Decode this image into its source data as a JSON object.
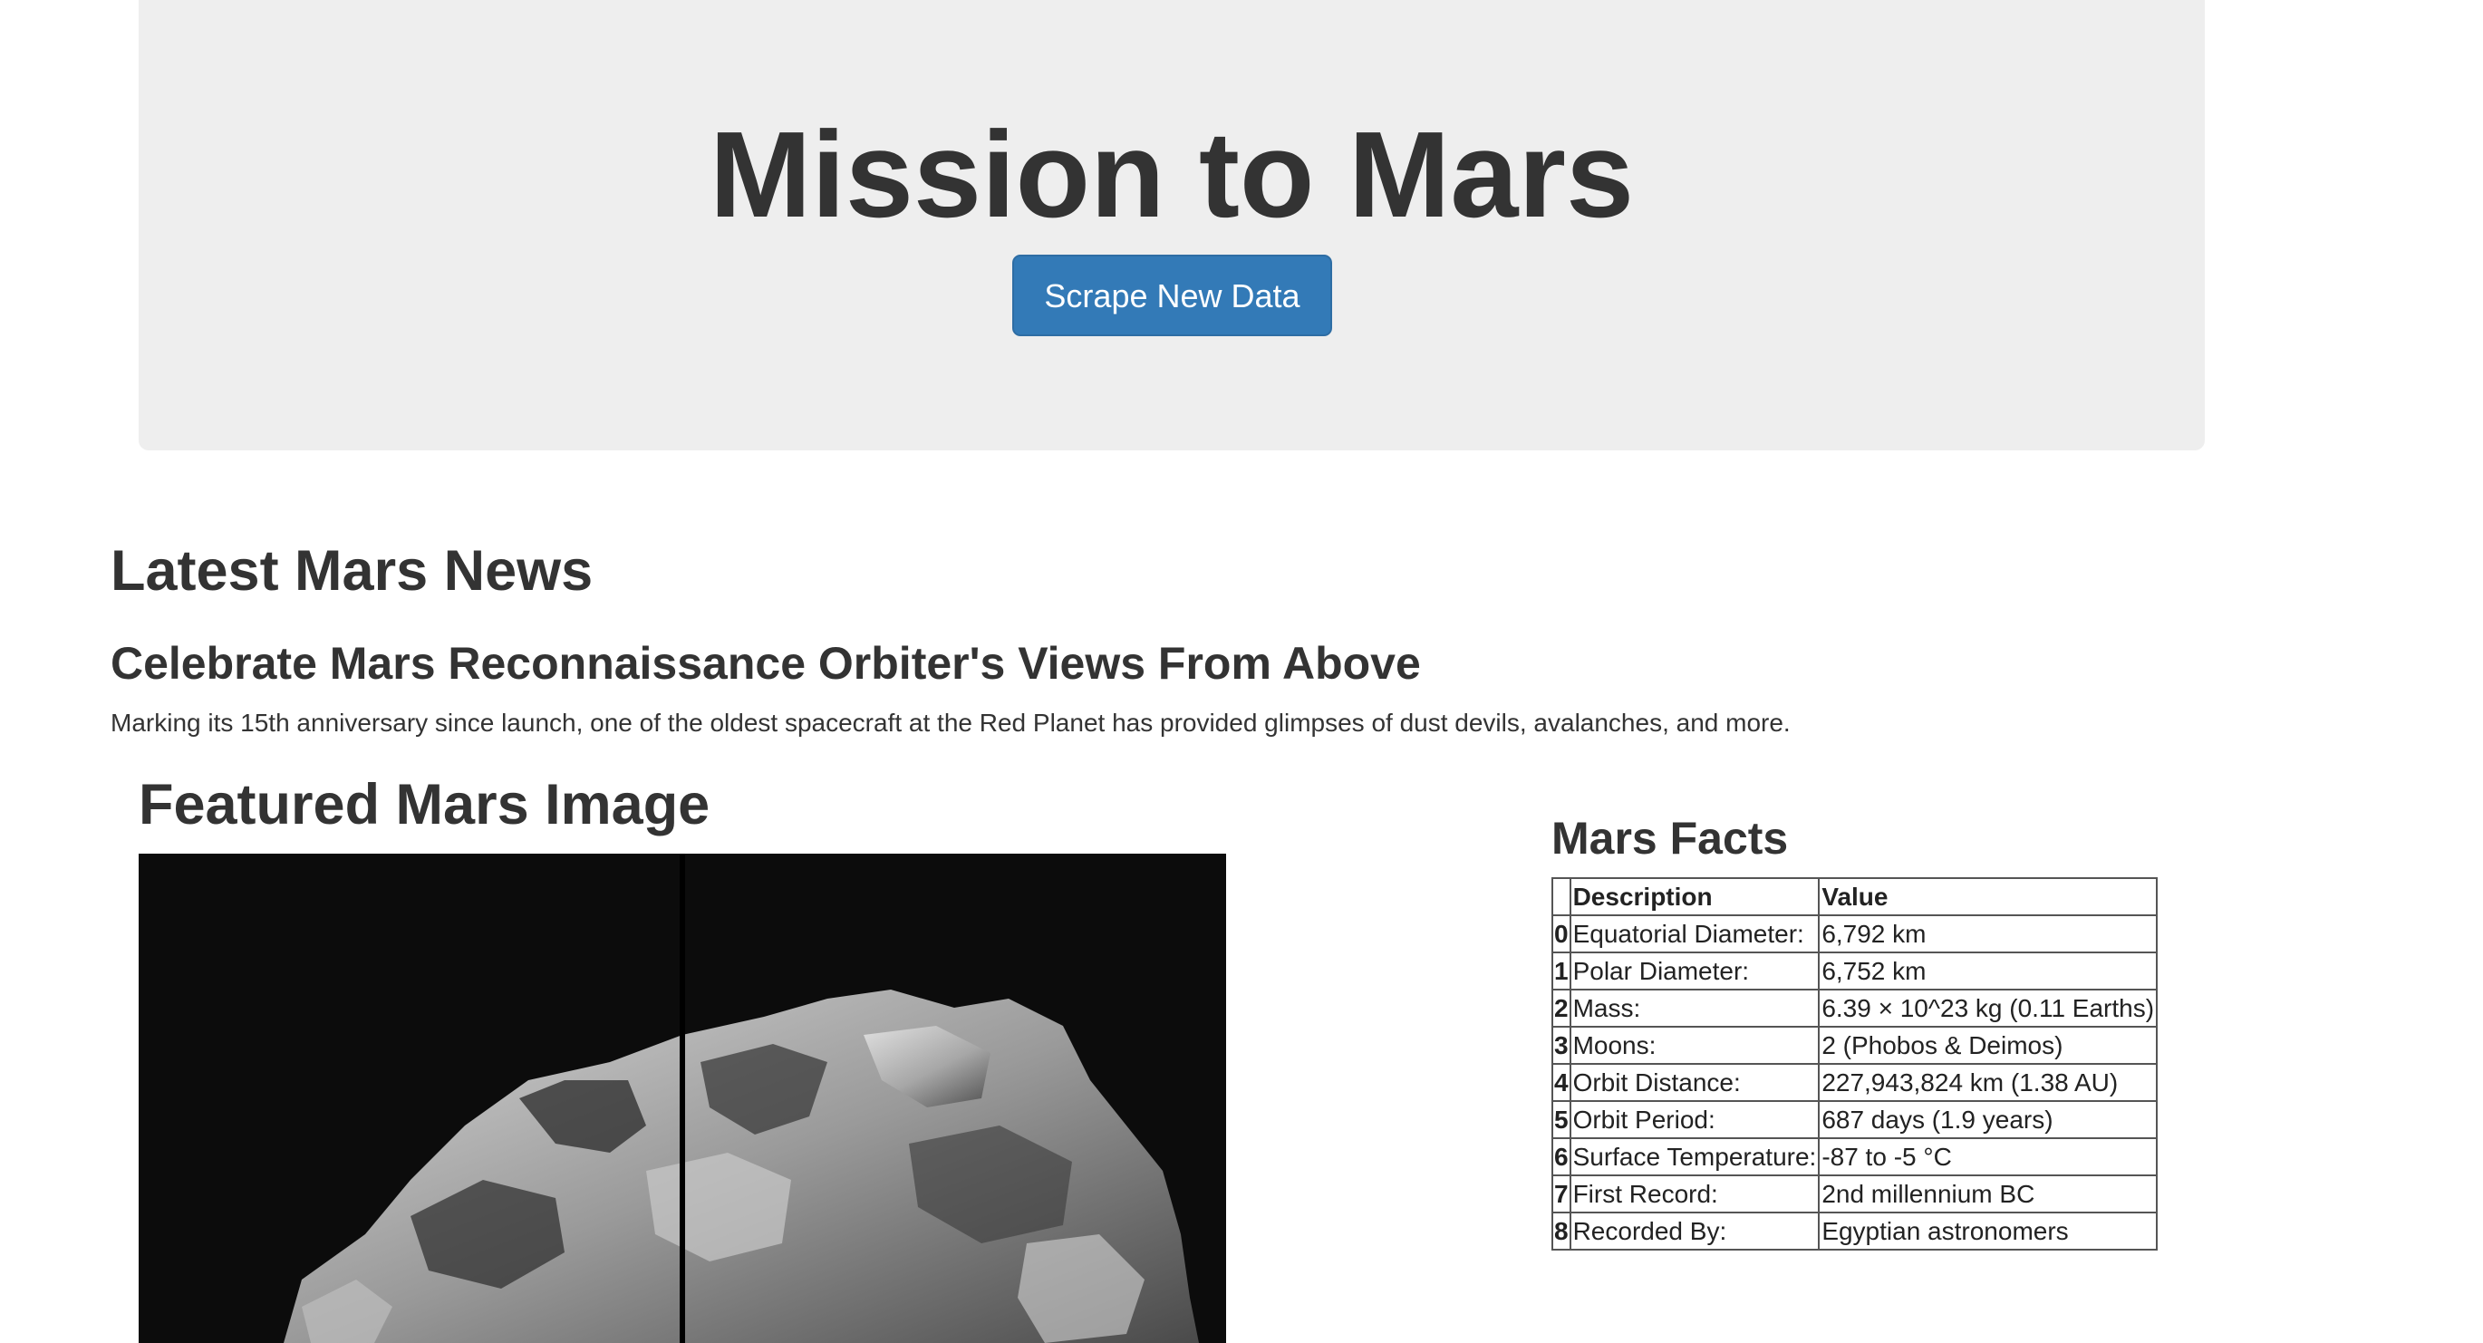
{
  "header": {
    "title": "Mission to Mars",
    "scrape_button_label": "Scrape New Data"
  },
  "news": {
    "section_heading": "Latest Mars News",
    "title": "Celebrate Mars Reconnaissance Orbiter's Views From Above",
    "paragraph": "Marking its 15th anniversary since launch, one of the oldest spacecraft at the Red Planet has provided glimpses of dust devils, avalanches, and more."
  },
  "featured_image": {
    "heading": "Featured Mars Image"
  },
  "facts": {
    "heading": "Mars Facts",
    "columns": [
      "",
      "Description",
      "Value"
    ],
    "rows": [
      {
        "index": "0",
        "description": "Equatorial Diameter:",
        "value": "6,792 km"
      },
      {
        "index": "1",
        "description": "Polar Diameter:",
        "value": "6,752 km"
      },
      {
        "index": "2",
        "description": "Mass:",
        "value": "6.39 × 10^23 kg (0.11 Earths)"
      },
      {
        "index": "3",
        "description": "Moons:",
        "value": "2 (Phobos & Deimos)"
      },
      {
        "index": "4",
        "description": "Orbit Distance:",
        "value": "227,943,824 km (1.38 AU)"
      },
      {
        "index": "5",
        "description": "Orbit Period:",
        "value": "687 days (1.9 years)"
      },
      {
        "index": "6",
        "description": "Surface Temperature:",
        "value": "-87 to -5 °C"
      },
      {
        "index": "7",
        "description": "First Record:",
        "value": "2nd millennium BC"
      },
      {
        "index": "8",
        "description": "Recorded By:",
        "value": "Egyptian astronomers"
      }
    ]
  }
}
